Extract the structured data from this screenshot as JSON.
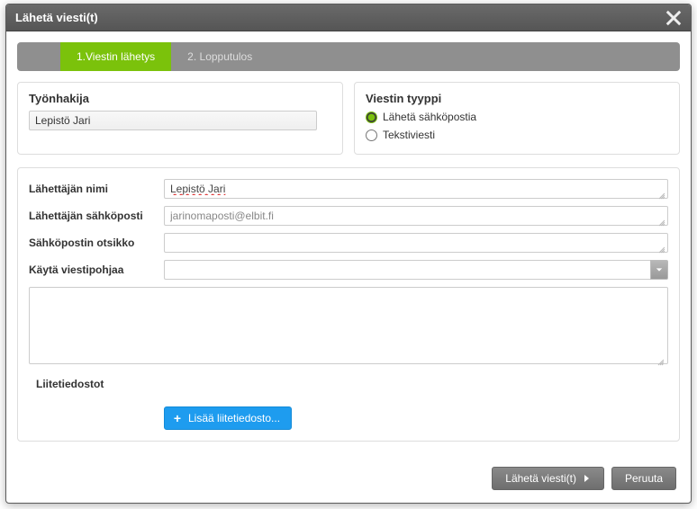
{
  "modal": {
    "title": "Lähetä viesti(t)"
  },
  "tabs": {
    "step1": "1.Viestin lähetys",
    "step2": "2. Lopputulos"
  },
  "applicant": {
    "heading": "Työnhakija",
    "name": "Lepistö Jari"
  },
  "messageType": {
    "heading": "Viestin tyyppi",
    "option_email": "Lähetä sähköpostia",
    "option_sms": "Tekstiviesti",
    "selected": "email"
  },
  "form": {
    "sender_name_label": "Lähettäjän nimi",
    "sender_name_value": "Lepistö Jari",
    "sender_email_label": "Lähettäjän sähköposti",
    "sender_email_value": "jarinomaposti@elbit.fi",
    "subject_label": "Sähköpostin otsikko",
    "subject_value": "",
    "template_label": "Käytä viestipohjaa",
    "template_value": "",
    "body_value": ""
  },
  "attachments": {
    "heading": "Liitetiedostot",
    "add_label": "Lisää liitetiedosto..."
  },
  "footer": {
    "send": "Lähetä viesti(t)",
    "cancel": "Peruuta"
  }
}
